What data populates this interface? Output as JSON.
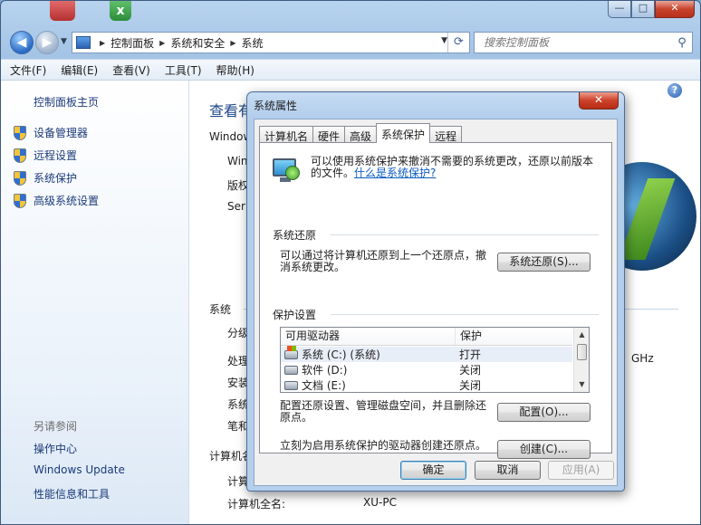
{
  "window": {
    "caption_min": "—",
    "caption_max": "□",
    "caption_close": "✕",
    "back_glyph": "◀",
    "forward_glyph": "▶"
  },
  "address": {
    "crumbs": [
      "控制面板",
      "系统和安全",
      "系统"
    ],
    "search_placeholder": "搜索控制面板"
  },
  "menu": [
    "文件(F)",
    "编辑(E)",
    "查看(V)",
    "工具(T)",
    "帮助(H)"
  ],
  "sidebar": {
    "home": "控制面板主页",
    "items": [
      "设备管理器",
      "远程设置",
      "系统保护",
      "高级系统设置"
    ],
    "see_also_title": "另请参阅",
    "see_also": [
      "操作中心",
      "Windows Update",
      "性能信息和工具"
    ]
  },
  "main": {
    "title": "查看有",
    "windows_edition": "Window",
    "row_win": "Win",
    "row_ver": "版权",
    "row_ser": "Ser",
    "system_section": "系统",
    "row_rating": "分级",
    "row_proc": "处理",
    "row_mem": "安装",
    "row_type": "系统",
    "row_pen": "笔和",
    "ghz": "GHz",
    "computer_section": "计算机名",
    "row_comp": "计算",
    "full_name_label": "计算机全名:",
    "full_name_value": "XU-PC"
  },
  "dialog": {
    "title": "系统属性",
    "close": "✕",
    "tabs": [
      "计算机名",
      "硬件",
      "高级",
      "系统保护",
      "远程"
    ],
    "active_tab": "系统保护",
    "intro": "可以使用系统保护来撤消不需要的系统更改，还原以前版本的文件。",
    "intro_link": "什么是系统保护?",
    "restore_group": "系统还原",
    "restore_text": "可以通过将计算机还原到上一个还原点，撤消系统更改。",
    "restore_button": "系统还原(S)...",
    "protect_group": "保护设置",
    "columns": [
      "可用驱动器",
      "保护"
    ],
    "drives": [
      {
        "name": "系统 (C:) (系统)",
        "state": "打开"
      },
      {
        "name": "软件 (D:)",
        "state": "关闭"
      },
      {
        "name": "文档 (E:)",
        "state": "关闭"
      }
    ],
    "configure_text": "配置还原设置、管理磁盘空间，并且删除还原点。",
    "configure_button": "配置(O)...",
    "create_text": "立刻为启用系统保护的驱动器创建还原点。",
    "create_button": "创建(C)...",
    "ok": "确定",
    "cancel": "取消",
    "apply": "应用(A)"
  }
}
